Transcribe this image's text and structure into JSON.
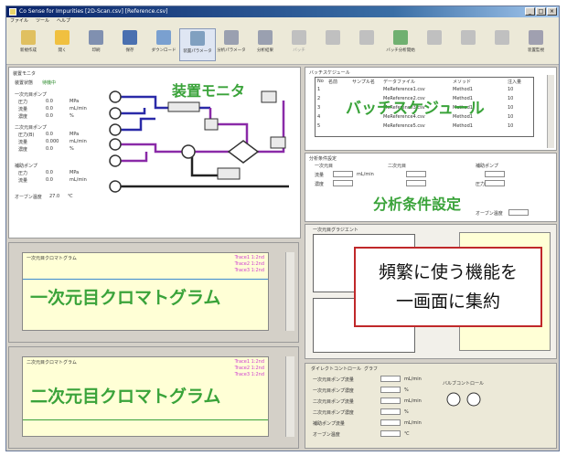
{
  "window": {
    "title": "Co Sense for Impurities [2D-Scan.csv] [Reference.csv]"
  },
  "menubar": {
    "items": [
      "ファイル",
      "ツール",
      "ヘルプ"
    ]
  },
  "toolbar": {
    "buttons": [
      {
        "label": "新規作成",
        "icon": "new-icon",
        "color": "#e0c060"
      },
      {
        "label": "開く",
        "icon": "open-icon",
        "color": "#f0c040"
      },
      {
        "label": "印刷",
        "icon": "print-icon",
        "color": "#8090b0"
      },
      {
        "label": "保存",
        "icon": "save-icon",
        "color": "#4a70b0"
      },
      {
        "label": "ダウンロード",
        "icon": "download-icon",
        "color": "#7aa0d0"
      },
      {
        "label": "装置パラメータ",
        "icon": "parameter-icon",
        "color": "#80a0c0"
      },
      {
        "label": "分析パラメータ",
        "icon": "analysis-icon",
        "color": "#9aa0b0"
      },
      {
        "label": "分析結果",
        "icon": "result-icon",
        "color": "#9aa0b0"
      },
      {
        "label": "バッチ",
        "icon": "batch-icon",
        "color": "#c0c0c0"
      },
      {
        "label": "",
        "icon": "grid-icon",
        "color": "#c0c0c0"
      },
      {
        "label": "",
        "icon": "grid-icon",
        "color": "#c0c0c0"
      },
      {
        "label": "バッチ分析開始",
        "icon": "start-icon",
        "color": "#70b070"
      },
      {
        "label": "",
        "icon": "stop-icon",
        "color": "#c0c0c0"
      },
      {
        "label": "",
        "icon": "pause-icon",
        "color": "#c0c0c0"
      },
      {
        "label": "",
        "icon": "grid-icon",
        "color": "#c0c0c0"
      },
      {
        "label": "装置監視",
        "icon": "monitor-icon",
        "color": "#a0a0b0"
      }
    ]
  },
  "monitor": {
    "heading": "装置モニタ",
    "status_label": "装置状態",
    "status_value": "待機中",
    "pump1": {
      "title": "一次元目ポンプ",
      "rows": [
        [
          "圧力",
          "0.0",
          "MPa"
        ],
        [
          "流量",
          "0.0",
          "mL/min"
        ],
        [
          "濃度",
          "0.0",
          "%"
        ]
      ]
    },
    "pump2": {
      "title": "二次元目ポンプ",
      "rows": [
        [
          "圧力(B)",
          "0.0",
          "MPa"
        ],
        [
          "流量",
          "0.000",
          "mL/min"
        ],
        [
          "濃度",
          "0.0",
          "%"
        ]
      ]
    },
    "pump3": {
      "title": "補助ポンプ",
      "rows": [
        [
          "圧力",
          "0.0",
          "MPa"
        ],
        [
          "流量",
          "0.0",
          "mL/min"
        ]
      ]
    },
    "oven_label": "オーブン温度",
    "oven_value": "27.0",
    "oven_unit": "℃"
  },
  "batch": {
    "heading": "バッチスケジュール",
    "columns": [
      "No",
      "名前",
      "サンプル名",
      "データファイル",
      "メソッド",
      "注入量"
    ],
    "rows": [
      [
        "1",
        "",
        "",
        "MeReference1.csv",
        "Method1",
        "10"
      ],
      [
        "2",
        "",
        "",
        "MeReference2.csv",
        "Method1",
        "10"
      ],
      [
        "3",
        "",
        "",
        "MeReference3.csv",
        "Method1",
        "10"
      ],
      [
        "4",
        "",
        "",
        "MeReference4.csv",
        "Method1",
        "10"
      ],
      [
        "5",
        "",
        "",
        "MeReference5.csv",
        "Method1",
        "10"
      ]
    ]
  },
  "conditions": {
    "heading": "分析条件設定",
    "group1": "一次元目",
    "group2": "二次元目",
    "group3": "補助ポンプ",
    "flow_label": "流量",
    "conc_label": "濃度",
    "pressure_label": "圧力",
    "flow_unit": "mL/min",
    "oven_label": "オーブン温度"
  },
  "chart1": {
    "heading": "一次元目クロマトグラム",
    "legend": [
      "Trace1 1:2nd",
      "Trace2 1:2nd",
      "Trace3 1:2nd"
    ]
  },
  "chart2": {
    "heading": "二次元目クロマトグラム",
    "legend": [
      "Trace1 1:2nd",
      "Trace2 1:2nd",
      "Trace3 1:2nd"
    ]
  },
  "gradient": {
    "heading": "一次元目グラジエント"
  },
  "callout": {
    "line1": "頻繁に使う機能を",
    "line2": "一画面に集約"
  },
  "direct": {
    "tabs": [
      "ダイレクトコントロール",
      "グラフ"
    ],
    "rows": [
      "一次元目ポンプ流量",
      "一次元目ポンプ濃度",
      "二次元目ポンプ流量",
      "二次元目ポンプ濃度",
      "補助ポンプ流量",
      "オーブン温度"
    ],
    "units": [
      "mL/min",
      "%",
      "mL/min",
      "%",
      "mL/min",
      "℃"
    ],
    "valve_label": "バルブコントロール"
  }
}
